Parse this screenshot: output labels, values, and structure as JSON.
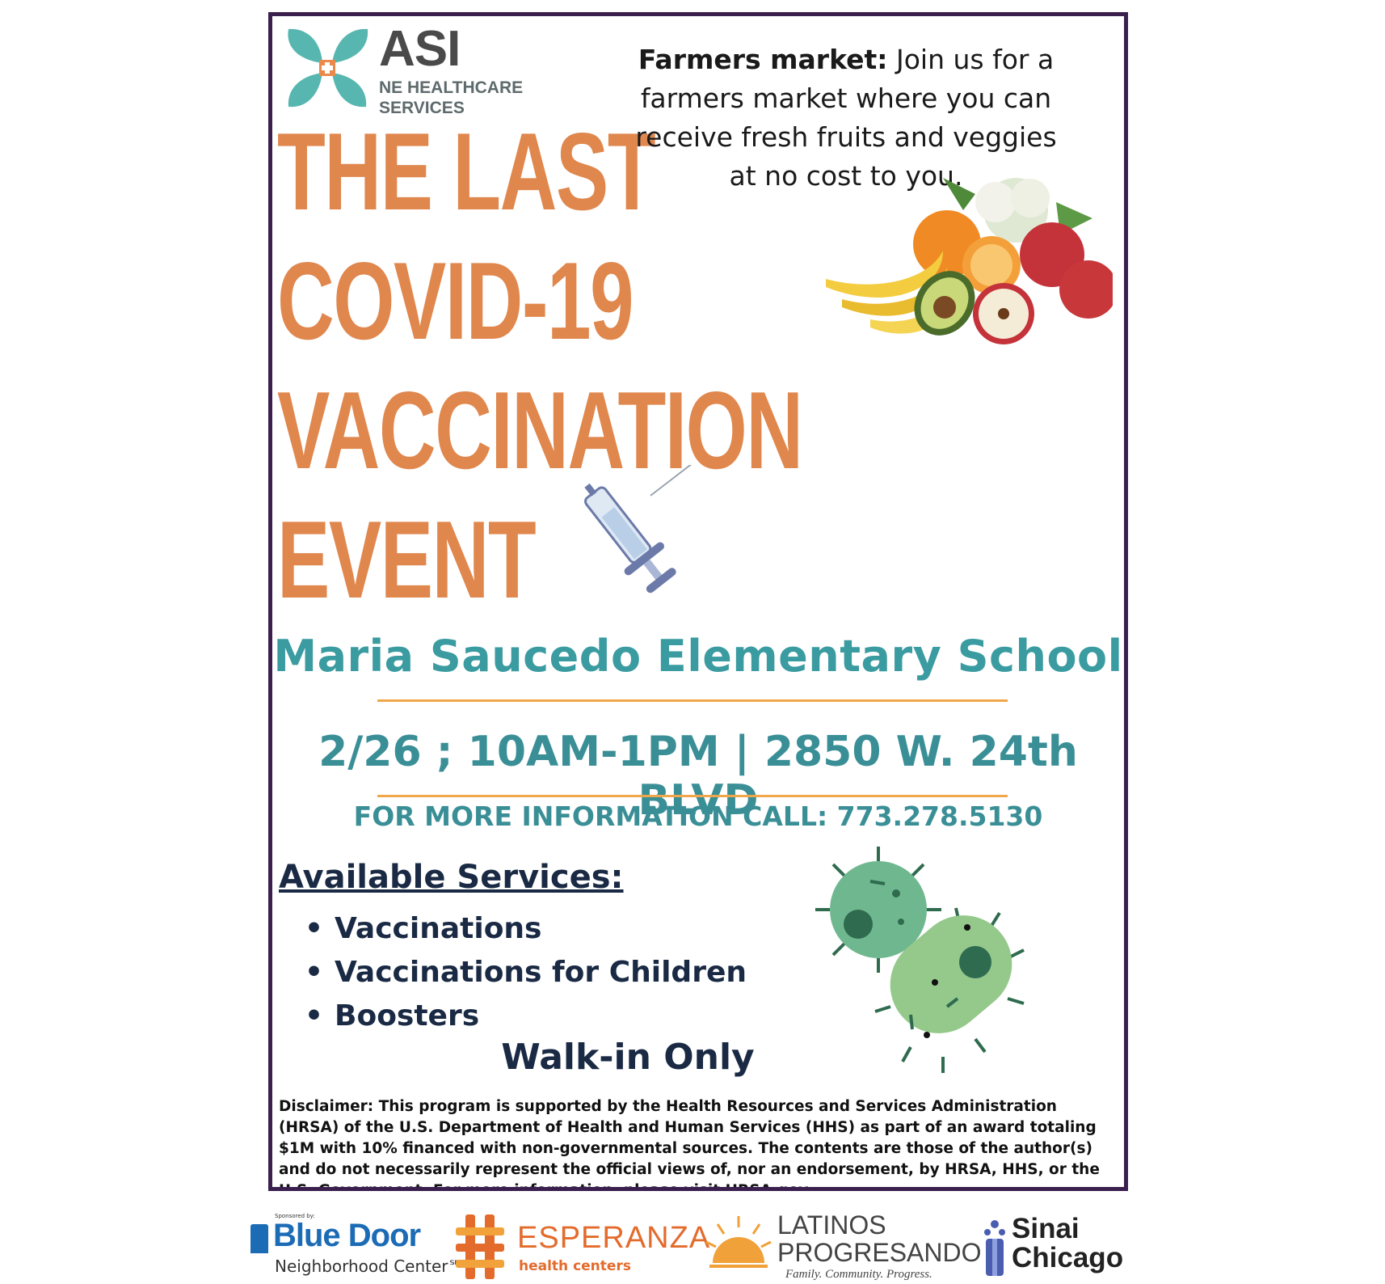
{
  "logo": {
    "name": "ASI",
    "subtitle": "NE HEALTHCARE SERVICES"
  },
  "headline": {
    "lines": [
      "THE LAST",
      "COVID-19",
      "VACCINATION",
      "EVENT"
    ]
  },
  "farmers_market": {
    "label": "Farmers market:",
    "text": " Join us for a farmers market where you can receive fresh fruits and veggies at no cost to you."
  },
  "event": {
    "location": "Maria Saucedo Elementary School",
    "when_where": "2/26 ; 10AM-1PM | 2850 W. 24th BLVD",
    "info": "FOR MORE INFORMATION CALL: 773.278.5130"
  },
  "services": {
    "title": "Available Services:",
    "items": [
      "Vaccinations",
      "Vaccinations for Children",
      "Boosters"
    ],
    "walk_in": "Walk-in Only"
  },
  "disclaimer": "Disclaimer: This program is supported by the Health Resources and Services Administration (HRSA) of the U.S. Department of Health and Human Services (HHS) as part of an award totaling $1M with 10% financed with non-governmental sources. The contents are those of the author(s) and do not necessarily represent the official views of, nor an endorsement, by HRSA, HHS, or the U.S. Government. For more information, please visit HRSA.gov.",
  "sponsors": {
    "label": "Sponsored by:",
    "blue_door": {
      "name": "Blue Door",
      "sub": "Neighborhood Center℠"
    },
    "esperanza": {
      "name": "ESPERANZA",
      "sub": "health centers"
    },
    "latinos": {
      "name": "LATINOS PROGRESANDO",
      "sub": "Family. Community. Progress."
    },
    "sinai": {
      "name": "Sinai Chicago"
    }
  },
  "colors": {
    "headline": "#e0874d",
    "teal": "#3a9ba1",
    "navy": "#1a2a44",
    "border": "#3b1f4e",
    "rule": "#f0a64a"
  },
  "icons": [
    "asi-logo-icon",
    "produce-icon",
    "syringe-icon",
    "virus-icon",
    "bacteria-icon"
  ]
}
